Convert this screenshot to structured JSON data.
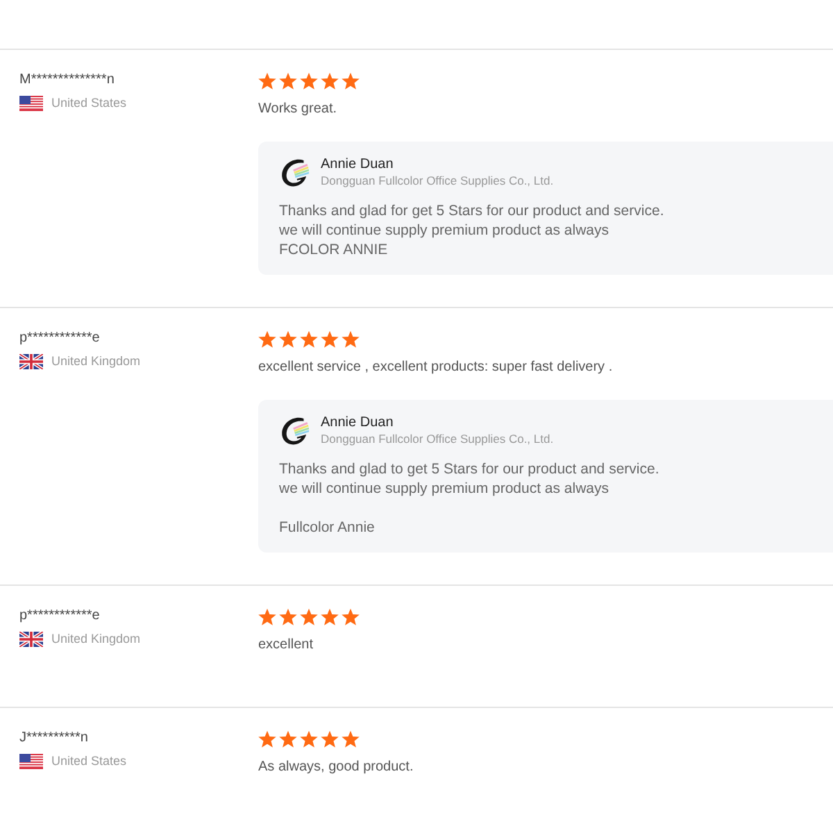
{
  "reviews": [
    {
      "reviewer": {
        "name": "M**************n",
        "country": "United States",
        "kind": "us"
      },
      "stars": 5,
      "comment": "Works great.",
      "reply": {
        "author": "Annie Duan",
        "company": "Dongguan Fullcolor Office Supplies Co., Ltd.",
        "text": "Thanks and glad for get 5 Stars for our product and service.\nwe will continue supply premium product as always\nFCOLOR ANNIE"
      }
    },
    {
      "reviewer": {
        "name": "p************e",
        "country": "United Kingdom",
        "kind": "gb"
      },
      "stars": 5,
      "comment": "excellent service , excellent products: super fast delivery .",
      "reply": {
        "author": "Annie Duan",
        "company": "Dongguan Fullcolor Office Supplies Co., Ltd.",
        "text": "Thanks and glad to get 5 Stars for our product and service.\nwe will continue supply premium product as always\n\nFullcolor Annie"
      }
    },
    {
      "reviewer": {
        "name": "p************e",
        "country": "United Kingdom",
        "kind": "gb"
      },
      "stars": 5,
      "comment": "excellent"
    },
    {
      "reviewer": {
        "name": "J**********n",
        "country": "United States",
        "kind": "us"
      },
      "stars": 5,
      "comment": "As always, good product."
    }
  ]
}
